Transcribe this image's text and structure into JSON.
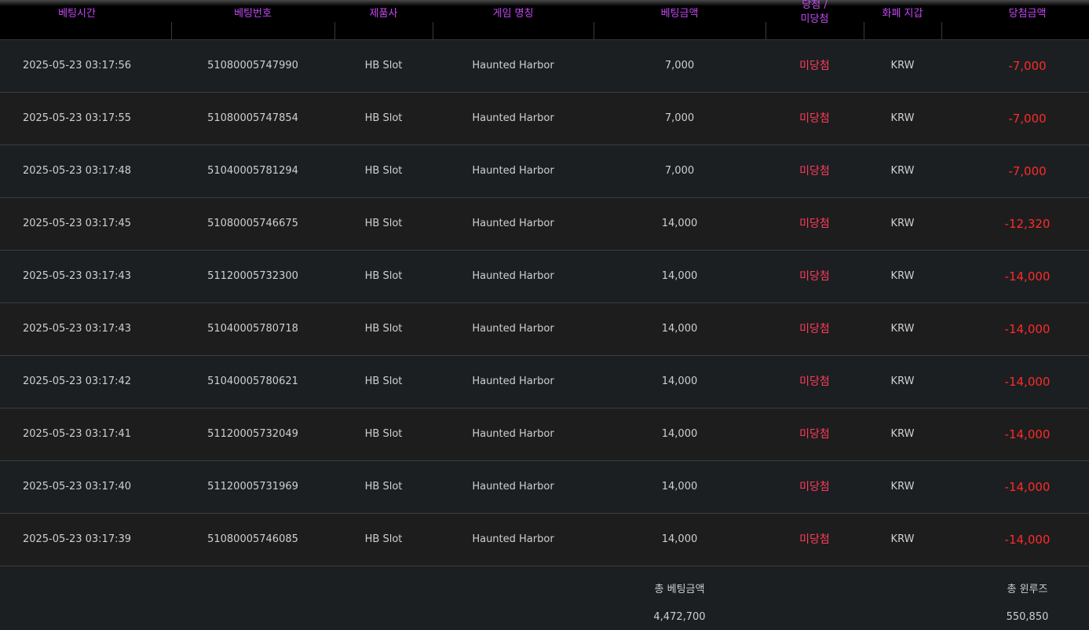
{
  "table": {
    "headers": [
      {
        "key": "bet_time",
        "label": "베팅시간"
      },
      {
        "key": "bet_number",
        "label": "베팅번호"
      },
      {
        "key": "provider",
        "label": "제품사"
      },
      {
        "key": "game_name",
        "label": "게임 명칭"
      },
      {
        "key": "bet_amount",
        "label": "베팅금액"
      },
      {
        "key": "result",
        "label_line1": "당첨 /",
        "label_line2": "미당첨"
      },
      {
        "key": "currency",
        "label": "화폐 지갑"
      },
      {
        "key": "win_amount",
        "label": "당첨금액"
      }
    ],
    "rows": [
      {
        "time": "2025-05-23 03:17:56",
        "number": "51080005747990",
        "provider": "HB Slot",
        "game": "Haunted Harbor",
        "bet": "7,000",
        "status": "미당첨",
        "currency": "KRW",
        "win": "-7,000"
      },
      {
        "time": "2025-05-23 03:17:55",
        "number": "51080005747854",
        "provider": "HB Slot",
        "game": "Haunted Harbor",
        "bet": "7,000",
        "status": "미당첨",
        "currency": "KRW",
        "win": "-7,000"
      },
      {
        "time": "2025-05-23 03:17:48",
        "number": "51040005781294",
        "provider": "HB Slot",
        "game": "Haunted Harbor",
        "bet": "7,000",
        "status": "미당첨",
        "currency": "KRW",
        "win": "-7,000"
      },
      {
        "time": "2025-05-23 03:17:45",
        "number": "51080005746675",
        "provider": "HB Slot",
        "game": "Haunted Harbor",
        "bet": "14,000",
        "status": "미당첨",
        "currency": "KRW",
        "win": "-12,320"
      },
      {
        "time": "2025-05-23 03:17:43",
        "number": "51120005732300",
        "provider": "HB Slot",
        "game": "Haunted Harbor",
        "bet": "14,000",
        "status": "미당첨",
        "currency": "KRW",
        "win": "-14,000"
      },
      {
        "time": "2025-05-23 03:17:43",
        "number": "51040005780718",
        "provider": "HB Slot",
        "game": "Haunted Harbor",
        "bet": "14,000",
        "status": "미당첨",
        "currency": "KRW",
        "win": "-14,000"
      },
      {
        "time": "2025-05-23 03:17:42",
        "number": "51040005780621",
        "provider": "HB Slot",
        "game": "Haunted Harbor",
        "bet": "14,000",
        "status": "미당첨",
        "currency": "KRW",
        "win": "-14,000"
      },
      {
        "time": "2025-05-23 03:17:41",
        "number": "51120005732049",
        "provider": "HB Slot",
        "game": "Haunted Harbor",
        "bet": "14,000",
        "status": "미당첨",
        "currency": "KRW",
        "win": "-14,000"
      },
      {
        "time": "2025-05-23 03:17:40",
        "number": "51120005731969",
        "provider": "HB Slot",
        "game": "Haunted Harbor",
        "bet": "14,000",
        "status": "미당첨",
        "currency": "KRW",
        "win": "-14,000"
      },
      {
        "time": "2025-05-23 03:17:39",
        "number": "51080005746085",
        "provider": "HB Slot",
        "game": "Haunted Harbor",
        "bet": "14,000",
        "status": "미당첨",
        "currency": "KRW",
        "win": "-14,000"
      }
    ]
  },
  "summary": {
    "total_bet_label": "총 베팅금액",
    "total_bet_value": "4,472,700",
    "total_winloss_label": "총 윈루즈",
    "total_winloss_value": "550,850"
  },
  "colors": {
    "header_text": "#c548f5",
    "status_text": "#ff3b5c",
    "win_text": "#ff2a2a",
    "body_text": "#cfcfcf"
  }
}
